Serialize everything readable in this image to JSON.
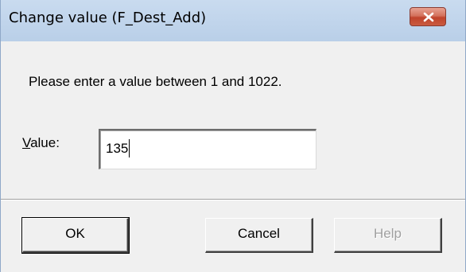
{
  "window": {
    "title": "Change value (F_Dest_Add)"
  },
  "dialog": {
    "message": "Please enter a value between 1 and 1022.",
    "value_label_mnemonic": "V",
    "value_label_rest": "alue:",
    "value": "135"
  },
  "buttons": {
    "ok": "OK",
    "cancel": "Cancel",
    "help": "Help"
  },
  "icons": {
    "close": "close-icon"
  },
  "colors": {
    "titlebar": "#c4d7ee",
    "close_button": "#c9503a",
    "dialog_background": "#f0f0f0",
    "disabled_text": "#a0a0a0"
  }
}
